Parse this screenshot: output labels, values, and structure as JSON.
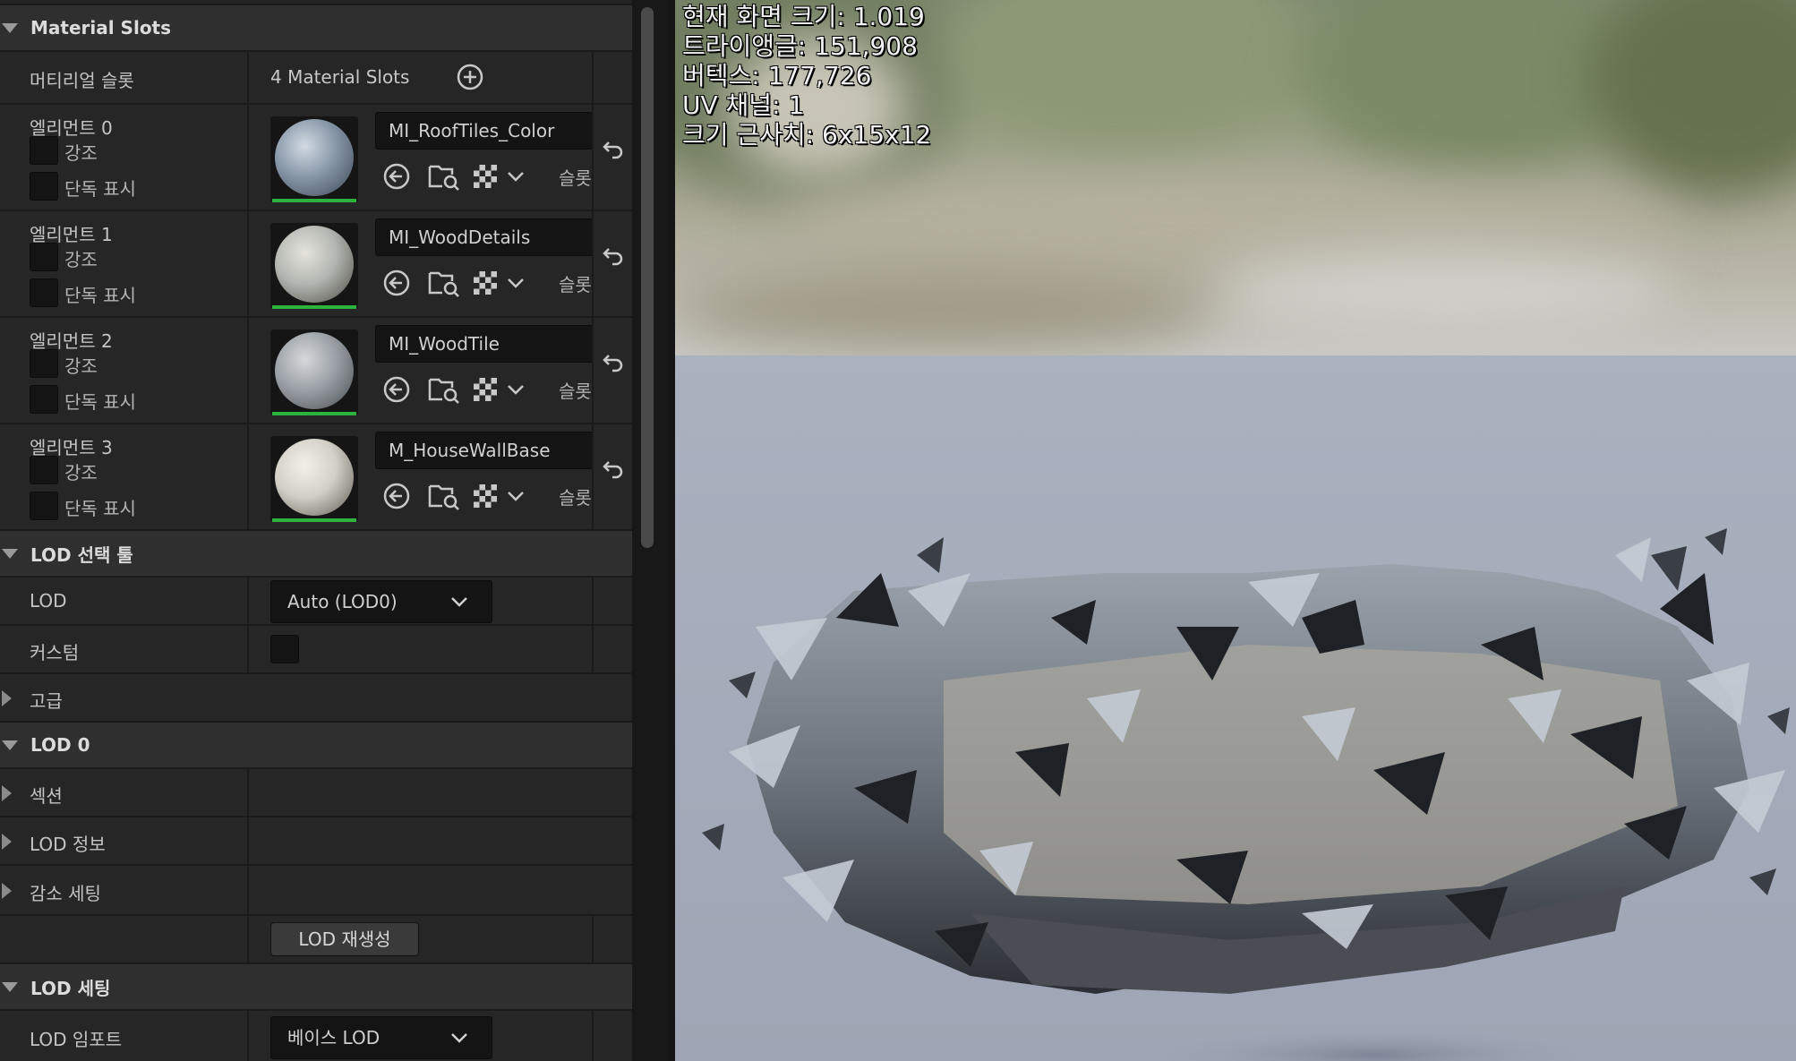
{
  "material_slots": {
    "header": "Material Slots",
    "row_label": "머티리얼 슬롯",
    "count_text": "4 Material Slots",
    "highlight_label": "강조",
    "isolate_label": "단독 표시",
    "slot_label": "슬롯",
    "elements": [
      {
        "title": "엘리먼트 0",
        "material": "MI_RoofTiles_Color",
        "thumb_color": "#8b9aaa"
      },
      {
        "title": "엘리먼트 1",
        "material": "MI_WoodDetails",
        "thumb_color": "#b3b6b0"
      },
      {
        "title": "엘리먼트 2",
        "material": "MI_WoodTile",
        "thumb_color": "#9aa0a6"
      },
      {
        "title": "엘리먼트 3",
        "material": "M_HouseWallBase",
        "thumb_color": "#d2d0c6"
      }
    ]
  },
  "lod_picker": {
    "header": "LOD 선택 툴",
    "lod_label": "LOD",
    "lod_value": "Auto (LOD0)",
    "custom_label": "커스텀",
    "advanced_label": "고급"
  },
  "lod0": {
    "header": "LOD 0",
    "sections_label": "섹션",
    "lod_info_label": "LOD 정보",
    "reduction_label": "감소 세팅",
    "regenerate_button": "LOD 재생성"
  },
  "lod_settings": {
    "header": "LOD 세팅",
    "import_label": "LOD 임포트",
    "import_value": "베이스 LOD"
  },
  "viewport_stats": {
    "screen_size": "현재 화면 크기: 1.019",
    "triangles": "트라이앵글: 151,908",
    "vertices": "버텍스: 177,726",
    "uv_channels": "UV 채널: 1",
    "approx_size": "크기 근사치: 6x15x12"
  },
  "colors": {
    "panel_bg": "#242424",
    "header_bg": "#2f2f2f",
    "field_bg": "#141414",
    "accent_green": "#2bb33d",
    "floor": "#a4abb9"
  }
}
